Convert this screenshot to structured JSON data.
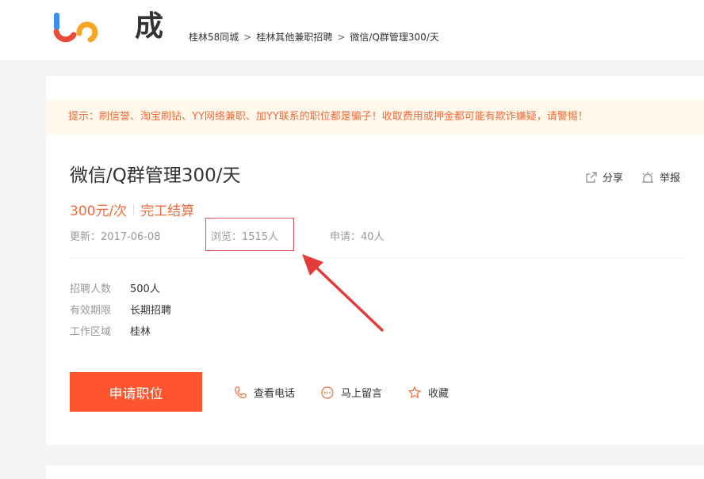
{
  "header": {
    "logo_text": "成",
    "breadcrumb": [
      "桂林58同城",
      "桂林其他兼职招聘",
      "微信/Q群管理300/天"
    ],
    "breadcrumb_sep": ">"
  },
  "notice": {
    "text": "提示：刷信誉、淘宝刷钻、YY网络兼职、加YY联系的职位都是骗子！收取费用或押金都可能有欺诈嫌疑，请警惕！"
  },
  "job": {
    "title": "微信/Q群管理300/天",
    "salary": "300元/次",
    "settlement": "完工结算",
    "updated": "更新：2017-06-08",
    "views": "浏览：1515人",
    "applications": "申请：40人"
  },
  "top_actions": {
    "share": "分享",
    "report": "举报"
  },
  "details": [
    {
      "key": "招聘人数",
      "value": "500人"
    },
    {
      "key": "有效期限",
      "value": "长期招聘"
    },
    {
      "key": "工作区域",
      "value": "桂林"
    }
  ],
  "bottom_actions": {
    "apply": "申请职位",
    "phone": "查看电话",
    "message": "马上留言",
    "favorite": "收藏"
  },
  "colors": {
    "accent": "#ff552e",
    "warning_text": "#f26b3a",
    "highlight": "#e05050"
  }
}
